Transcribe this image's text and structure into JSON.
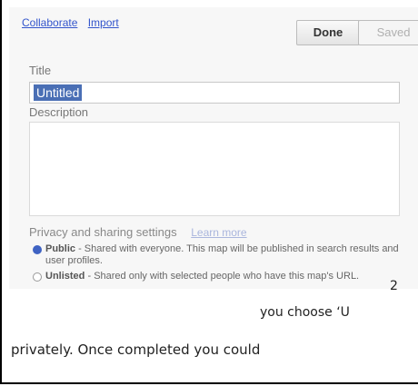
{
  "toolbar": {
    "collaborate_link": "Collaborate",
    "import_link": "Import",
    "done_button": "Done",
    "saved_button": "Saved"
  },
  "form": {
    "title_label": "Title",
    "title_value": "Untitled",
    "description_label": "Description",
    "description_value": ""
  },
  "privacy": {
    "heading": "Privacy and sharing settings",
    "learn_more": "Learn more",
    "options": [
      {
        "name": "Public",
        "desc": "Shared with everyone. This map will be published in search results and user profiles.",
        "selected": true
      },
      {
        "name": "Unlisted",
        "desc": "Shared only with selected people who have this map's URL.",
        "selected": false
      }
    ]
  },
  "caption": {
    "line1": "2",
    "line2": "you choose ‘U",
    "line3": "privately. Once completed you could"
  },
  "colors": {
    "link": "#3355cc",
    "selection": "#4a6fb5",
    "radio_selected": "#3f63c3"
  }
}
